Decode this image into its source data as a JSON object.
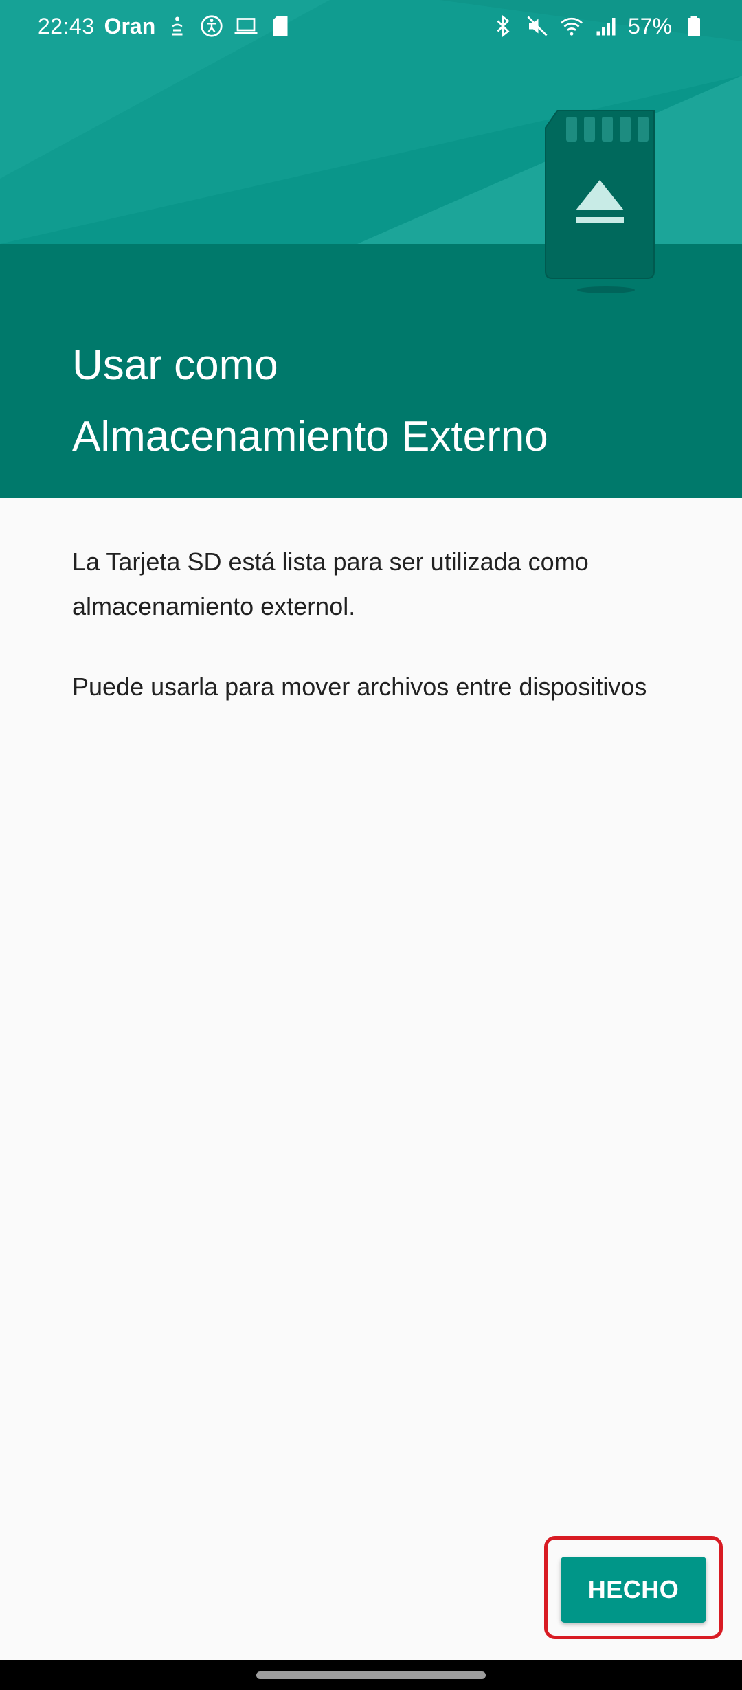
{
  "status_bar": {
    "time": "22:43",
    "carrier": "Oran",
    "battery": "57%",
    "left_icons": [
      "notification-app-icon",
      "accessibility-icon",
      "laptop-icon",
      "sd-card-icon"
    ],
    "right_icons": [
      "bluetooth-icon",
      "mute-icon",
      "wifi-icon",
      "signal-icon",
      "battery-icon"
    ]
  },
  "header": {
    "title_line1": "Usar como",
    "title_line2": "Almacenamiento Externo",
    "illustration": "sd-card-eject-illustration"
  },
  "body": {
    "paragraph1": "La Tarjeta SD está lista para ser utilizada como almacenamiento externol.",
    "paragraph2": "Puede usarla para mover archivos entre dispositivos"
  },
  "actions": {
    "done_label": "HECHO"
  },
  "colors": {
    "header_primary": "#00796b",
    "header_light": "#009688",
    "button": "#009688",
    "highlight": "#d81b23",
    "background": "#fafafa",
    "text": "#212121"
  }
}
